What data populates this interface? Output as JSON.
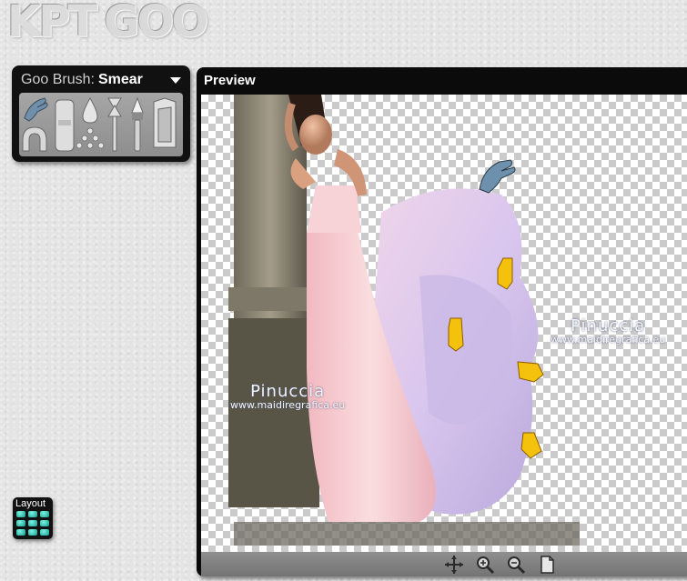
{
  "app": {
    "logo_primary": "KPT",
    "logo_secondary": "GOO"
  },
  "brush_panel": {
    "label": "Goo Brush:",
    "selected_brush": "Smear",
    "tools": [
      "hand-smear-icon",
      "eraser-icon",
      "drop-icon",
      "pinch-icon",
      "brush-icon",
      "frame-icon",
      "magnet-icon",
      "drops-icon"
    ]
  },
  "preview": {
    "title": "Preview",
    "watermark_left": {
      "name": "Pinuccia",
      "url": "www.maidiregrafica.eu"
    },
    "watermark_right": {
      "name": "Pinuccia",
      "url": "www.maidiregrafica.eu"
    },
    "toolbar": [
      "move-icon",
      "zoom-in-icon",
      "zoom-out-icon",
      "page-icon"
    ]
  },
  "layout_button": {
    "label": "Layout"
  },
  "colors": {
    "dress": "#f5c9cf",
    "dress_flow": "#c8bfe6",
    "panel": "#111111",
    "pointer": "#f4c20d"
  }
}
